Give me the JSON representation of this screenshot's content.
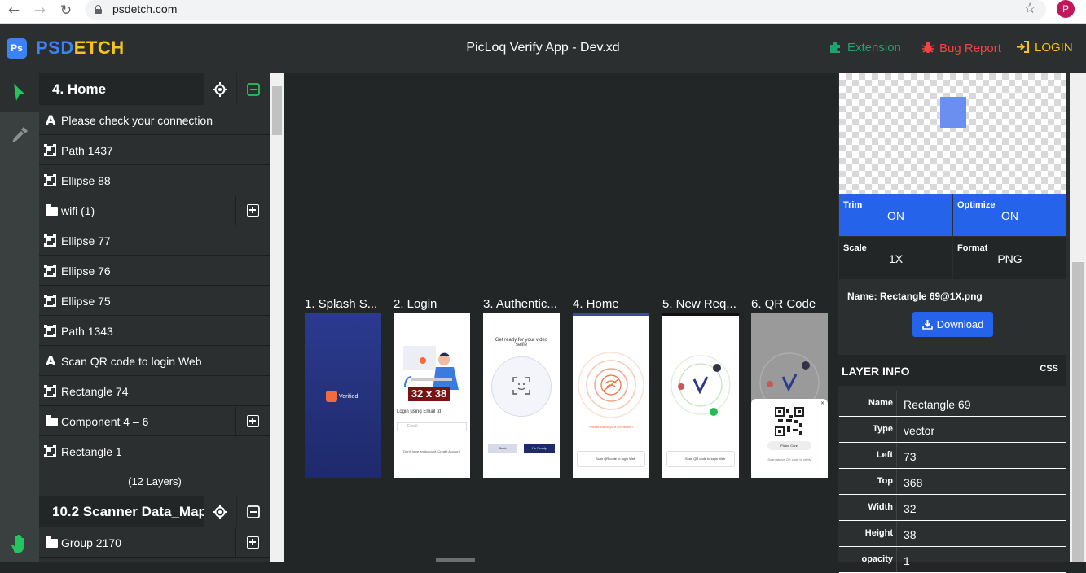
{
  "browser": {
    "url": "psdetch.com",
    "profile_initial": "P"
  },
  "header": {
    "logo_box": "Ps",
    "logo_ps": "PSD",
    "logo_etch": "ETCH",
    "title": "PicLoq Verify App - Dev.xd",
    "extension_label": "Extension",
    "bug_report_label": "Bug Report",
    "login_label": "LOGIN",
    "colors": {
      "extension": "#1fa36f",
      "bug_report": "#ef4444",
      "login": "#f5c518"
    }
  },
  "layers": {
    "group1_title": "4. Home",
    "items": [
      {
        "type": "text",
        "label": "Please check your connection"
      },
      {
        "type": "shape",
        "label": "Path 1437"
      },
      {
        "type": "shape",
        "label": "Ellipse 88"
      },
      {
        "type": "folder",
        "label": "wifi (1)"
      },
      {
        "type": "shape",
        "label": "Ellipse 77"
      },
      {
        "type": "shape",
        "label": "Ellipse 76"
      },
      {
        "type": "shape",
        "label": "Ellipse 75"
      },
      {
        "type": "shape",
        "label": "Path 1343"
      },
      {
        "type": "text",
        "label": "Scan QR code to login Web"
      },
      {
        "type": "shape",
        "label": "Rectangle 74"
      },
      {
        "type": "folder",
        "label": "Component 4 – 6"
      },
      {
        "type": "shape",
        "label": "Rectangle 1"
      }
    ],
    "count": "(12 Layers)",
    "group2_title": "10.2 Scanner Data_Map",
    "group2_items": [
      {
        "type": "folder",
        "label": "Group 2170"
      }
    ]
  },
  "artboards": [
    {
      "label": "1. Splash S...",
      "splash_text": "Verified"
    },
    {
      "label": "2. Login",
      "login_text": "Login using Email Id",
      "email_placeholder": "Email",
      "bottom_text": "Don't have an Account, Create Account",
      "measure": "32 x 38"
    },
    {
      "label": "3. Authentic...",
      "heading": "Get ready for your video selfie",
      "back": "Back",
      "ready": "I'm Ready"
    },
    {
      "label": "4. Home",
      "warning": "Please check your connection",
      "scan_text": "Scan QR code to login Web"
    },
    {
      "label": "5. New Req...",
      "scan_text": "Scan QR code to login Web"
    },
    {
      "label": "6. QR Code",
      "app_name": "Picloq Conn",
      "hint": "Scan above QR code to verify"
    }
  ],
  "export": {
    "trim_key": "Trim",
    "trim_val": "ON",
    "optimize_key": "Optimize",
    "optimize_val": "ON",
    "scale_key": "Scale",
    "scale_val": "1X",
    "format_key": "Format",
    "format_val": "PNG",
    "name": "Name: Rectangle 69@1X.png",
    "download_label": "Download"
  },
  "layer_info": {
    "title": "LAYER INFO",
    "css_label": "CSS",
    "props": [
      {
        "k": "Name",
        "v": "Rectangle 69"
      },
      {
        "k": "Type",
        "v": "vector"
      },
      {
        "k": "Left",
        "v": "73"
      },
      {
        "k": "Top",
        "v": "368"
      },
      {
        "k": "Width",
        "v": "32"
      },
      {
        "k": "Height",
        "v": "38"
      },
      {
        "k": "opacity",
        "v": "1"
      }
    ]
  },
  "colors": {
    "accent_blue": "#2563eb",
    "highlight_green": "#22c55e",
    "rectangle_fill": "#6b8ff0"
  }
}
